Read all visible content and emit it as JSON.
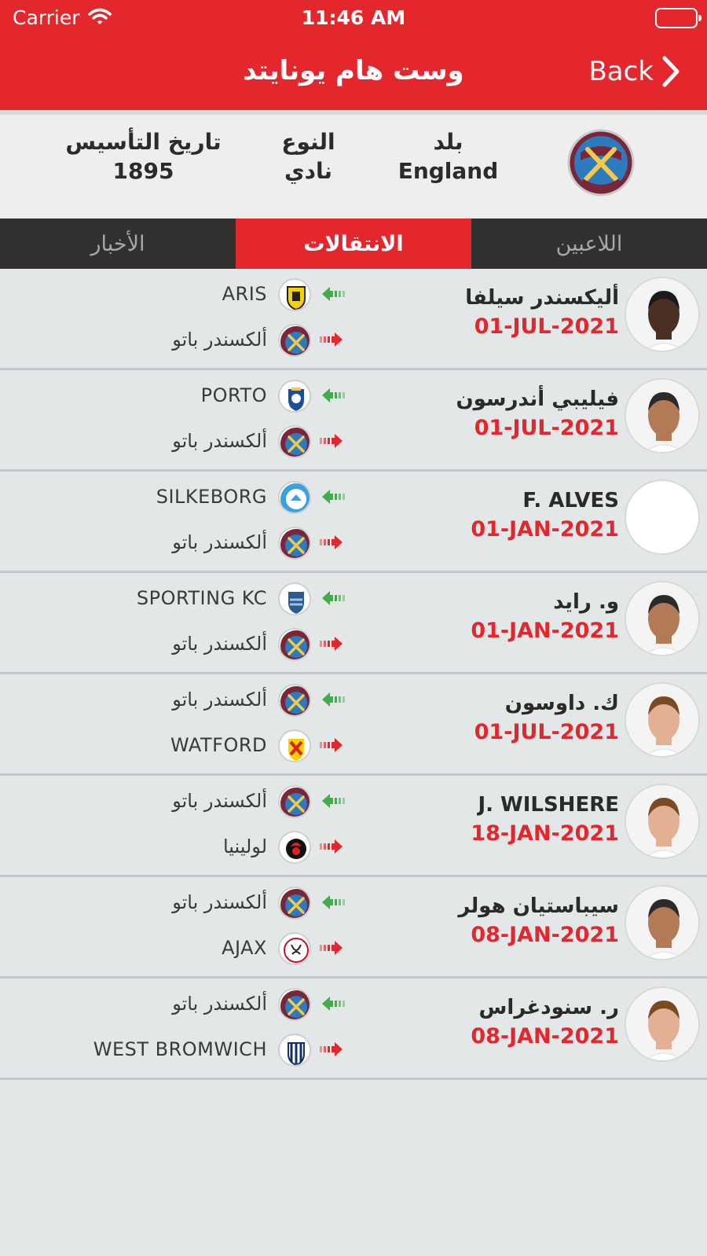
{
  "status": {
    "carrier": "Carrier",
    "time": "11:46 AM"
  },
  "nav": {
    "title": "وست هام  يونايتد",
    "back_label": "Back"
  },
  "club": {
    "country_label": "بلد",
    "country_value": "England",
    "type_label": "النوع",
    "type_value": "نادي",
    "founded_label": "تاريخ التأسيس",
    "founded_value": "1895"
  },
  "tabs": [
    {
      "label": "اللاعبين",
      "active": false
    },
    {
      "label": "الانتقالات",
      "active": true
    },
    {
      "label": "الأخبار",
      "active": false
    }
  ],
  "colors": {
    "brand_red": "#e4262d",
    "in_arrow": "#3fae49",
    "out_arrow": "#e4262d"
  },
  "transfers": [
    {
      "name": "أليكسندر سيلفا",
      "date": "01-JUL-2021",
      "in_club": "ARIS",
      "in_badge": "aris",
      "out_club": "ألكسندر باتو",
      "out_badge": "westham",
      "avatar": "dark"
    },
    {
      "name": "فيليبي أندرسون",
      "date": "01-JUL-2021",
      "in_club": "PORTO",
      "in_badge": "porto",
      "out_club": "ألكسندر باتو",
      "out_badge": "westham",
      "avatar": "medium"
    },
    {
      "name": "F. ALVES",
      "date": "01-JAN-2021",
      "in_club": "SILKEBORG",
      "in_badge": "silkeborg",
      "out_club": "ألكسندر باتو",
      "out_badge": "westham",
      "avatar": "empty"
    },
    {
      "name": "و. رايد",
      "date": "01-JAN-2021",
      "in_club": "SPORTING KC",
      "in_badge": "sportingkc",
      "out_club": "ألكسندر باتو",
      "out_badge": "westham",
      "avatar": "medium"
    },
    {
      "name": "ك. داوسون",
      "date": "01-JUL-2021",
      "in_club": "ألكسندر باتو",
      "in_badge": "westham",
      "out_club": "WATFORD",
      "out_badge": "watford",
      "avatar": "light"
    },
    {
      "name": "J. WILSHERE",
      "date": "18-JAN-2021",
      "in_club": "ألكسندر باتو",
      "in_badge": "westham",
      "out_club": "لولينيا",
      "out_badge": "bournemouth",
      "avatar": "light"
    },
    {
      "name": "سيباستيان هولر",
      "date": "08-JAN-2021",
      "in_club": "ألكسندر باتو",
      "in_badge": "westham",
      "out_club": "AJAX",
      "out_badge": "ajax",
      "avatar": "medium"
    },
    {
      "name": "ر. سنودغراس",
      "date": "08-JAN-2021",
      "in_club": "ألكسندر باتو",
      "in_badge": "westham",
      "out_club": "WEST BROMWICH",
      "out_badge": "westbrom",
      "avatar": "light"
    }
  ]
}
